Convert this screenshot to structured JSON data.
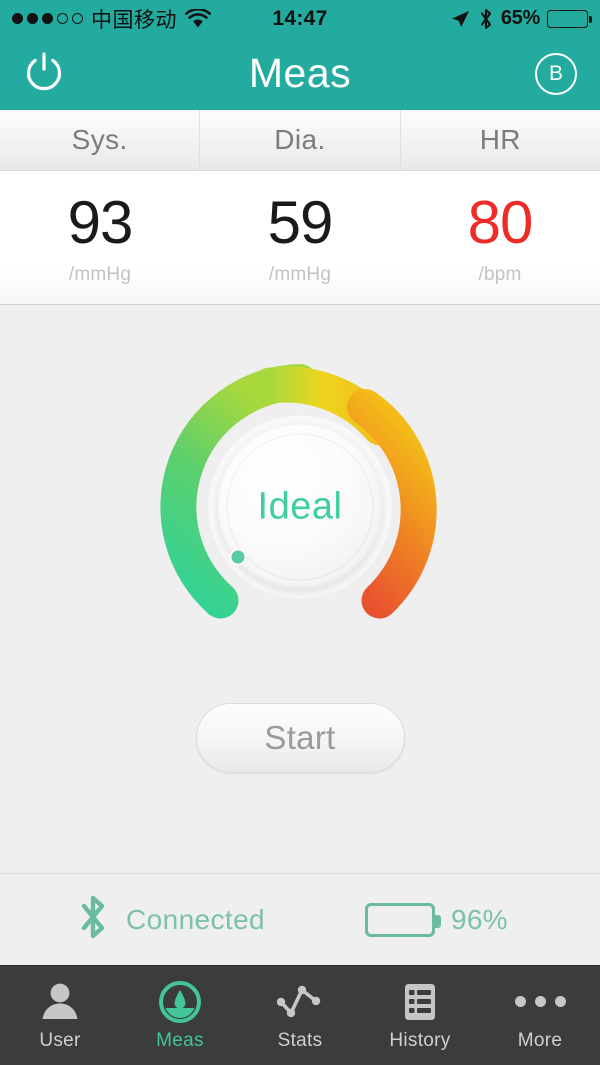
{
  "status_bar": {
    "signal_dots_filled": 3,
    "signal_dots_total": 5,
    "carrier": "中国移动",
    "wifi_icon": "wifi-icon",
    "time": "14:47",
    "location_icon": "location-arrow-icon",
    "bluetooth_icon": "bluetooth-icon",
    "battery_percent_label": "65%",
    "battery_level": 65
  },
  "navbar": {
    "power_icon": "power-icon",
    "title": "Meas",
    "right_button_label": "B",
    "background_color": "#22ab9e"
  },
  "readings": {
    "columns": [
      {
        "header": "Sys.",
        "value": "93",
        "unit": "/mmHg",
        "color": "#1a1a1a"
      },
      {
        "header": "Dia.",
        "value": "59",
        "unit": "/mmHg",
        "color": "#1a1a1a"
      },
      {
        "header": "HR",
        "value": "80",
        "unit": "/bpm",
        "color": "#ef2b28"
      }
    ]
  },
  "gauge": {
    "label": "Ideal",
    "label_color": "#3dcfa0",
    "pointer_icon": "gauge-pointer-dot",
    "arc_colors": {
      "start": "#2fd39a",
      "green": "#6cd05a",
      "yellow": "#ecd520",
      "orange": "#f5a417",
      "end": "#e8522f"
    }
  },
  "start_button": {
    "label": "Start"
  },
  "device_status": {
    "bluetooth_icon": "bluetooth-icon",
    "connection_text": "Connected",
    "battery_icon": "battery-icon",
    "battery_percent_label": "96%",
    "battery_level": 96,
    "accent_color": "#7dc1a9"
  },
  "tabbar": {
    "active_index": 1,
    "active_color": "#43c49b",
    "items": [
      {
        "label": "User",
        "icon": "user-icon"
      },
      {
        "label": "Meas",
        "icon": "gauge-icon"
      },
      {
        "label": "Stats",
        "icon": "line-chart-icon"
      },
      {
        "label": "History",
        "icon": "list-icon"
      },
      {
        "label": "More",
        "icon": "ellipsis-icon"
      }
    ]
  }
}
